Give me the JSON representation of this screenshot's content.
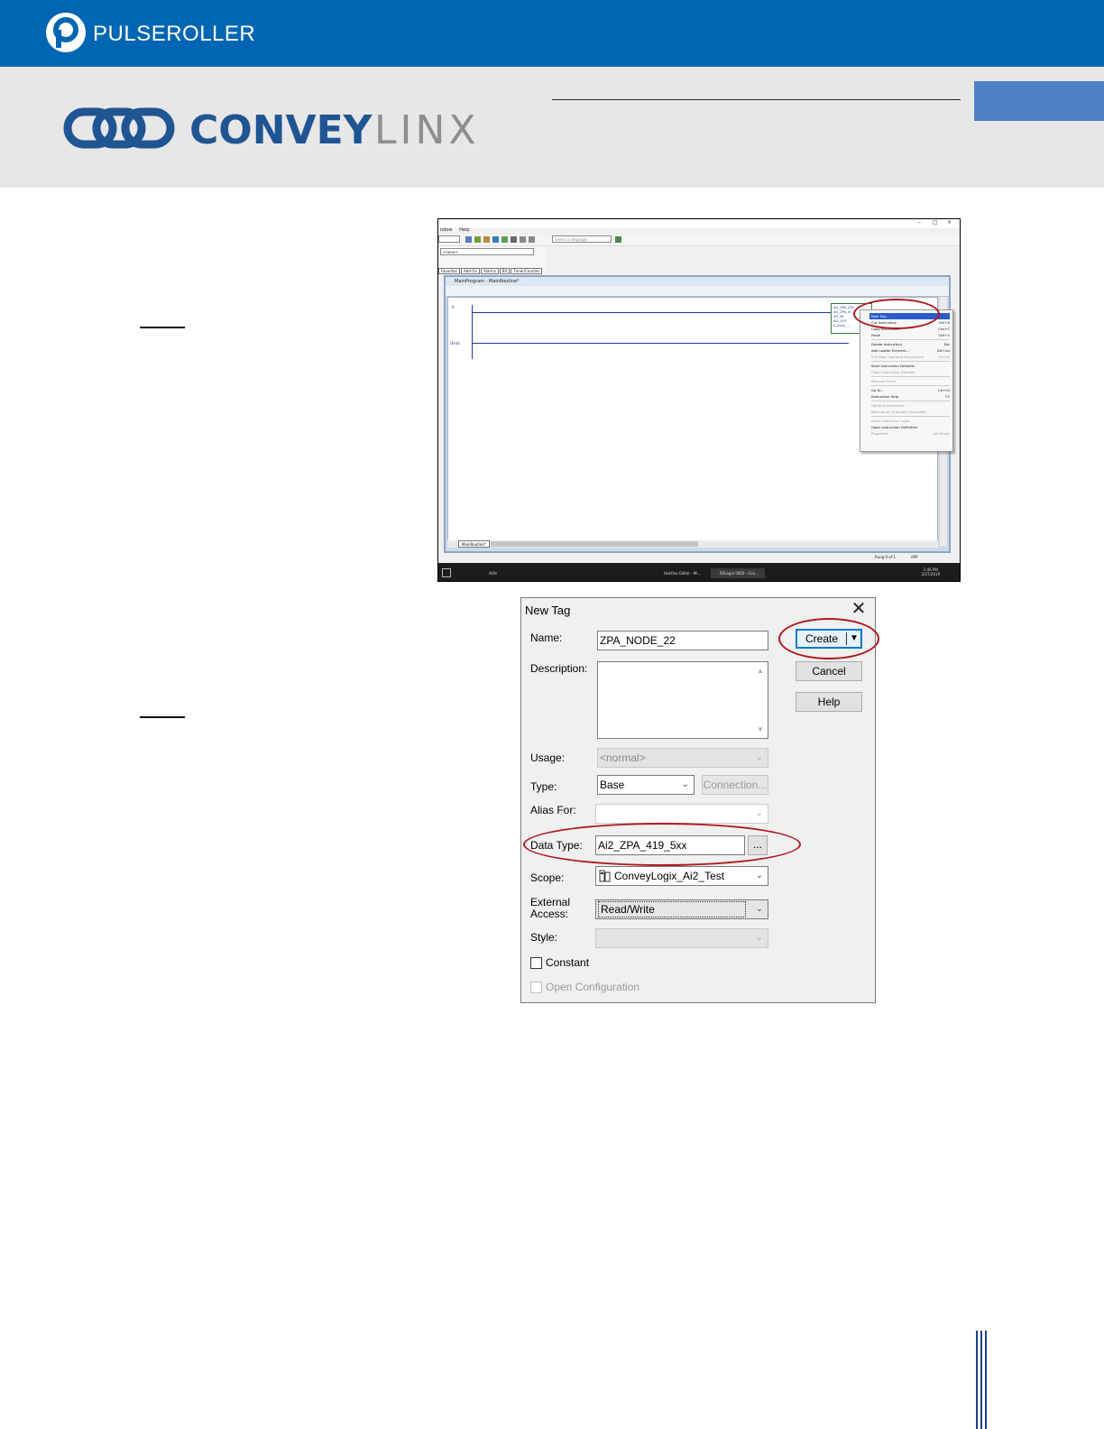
{
  "header": {
    "brand": "PULSEROLLER",
    "product_brand_bold": "CONVEY",
    "product_brand_light": "LINX",
    "colors": {
      "top_bar": "#0066b3",
      "band": "#e7e7e8",
      "accent_box": "#4f81c7",
      "conveylinx_blue": "#1f5592",
      "linx_gray": "#8d8e90",
      "highlight_red": "#b0161e"
    }
  },
  "screenshot1": {
    "menu": [
      "ndow",
      "Help"
    ],
    "language_placeholder": "Select a language...",
    "left_combo": "<none>",
    "tabs": [
      "Favorites",
      "Add-On",
      "Alarms",
      "Bit",
      "Timer/Counter"
    ],
    "child_window_title": "MainProgram - MainRoutine*",
    "rung_start": "0",
    "rung_end": "(End)",
    "aoi_lines": [
      "Ai2_ZPA_419",
      "Ai2_ZPA_In",
      "AI2_IN",
      "AI2_OUT",
      "S_Zone_..."
    ],
    "context_menu": [
      {
        "label": "New Tag...",
        "shortcut": "",
        "highlight": true
      },
      {
        "label": "Cut Instruction",
        "shortcut": "Ctrl+X"
      },
      {
        "label": "Copy Instruction",
        "shortcut": "Ctrl+C"
      },
      {
        "label": "Paste",
        "shortcut": "Ctrl+V"
      },
      {
        "sep": true
      },
      {
        "label": "Delete Instruction",
        "shortcut": "Del"
      },
      {
        "label": "Add Ladder Element...",
        "shortcut": "Alt+Ins"
      },
      {
        "label": "Edit Main Operand Description",
        "shortcut": "Ctrl+D",
        "disabled": true
      },
      {
        "sep": true
      },
      {
        "label": "Save Instruction Defaults",
        "shortcut": ""
      },
      {
        "label": "Clear Instruction Defaults",
        "shortcut": "",
        "disabled": true
      },
      {
        "sep": true
      },
      {
        "label": "Remove Force",
        "shortcut": "",
        "disabled": true
      },
      {
        "sep": true
      },
      {
        "label": "Go To...",
        "shortcut": "Ctrl+G"
      },
      {
        "label": "Instruction Help",
        "shortcut": "F1"
      },
      {
        "sep": true
      },
      {
        "label": "Optional Parameter",
        "shortcut": "",
        "disabled": true
      },
      {
        "label": "Remove All Unknown Parameter",
        "shortcut": "",
        "disabled": true
      },
      {
        "sep": true
      },
      {
        "label": "Open Instruction Logic",
        "shortcut": "",
        "disabled": true
      },
      {
        "label": "Open Instruction Definition",
        "shortcut": ""
      },
      {
        "label": "Properties",
        "shortcut": "Alt+Enter",
        "disabled": true
      }
    ],
    "sheet_tab": "MainRoutine*",
    "status_text": "Rung 0 of 1",
    "status_mode": "APP",
    "taskbar": [
      {
        "label": "AOIs"
      },
      {
        "label": "testOne Editor - Mi..."
      },
      {
        "label": "RSLogix 5000 - Con...",
        "active": true
      }
    ],
    "clock_time": "1:46 PM",
    "clock_date": "2/27/2019"
  },
  "dialog": {
    "title": "New Tag",
    "close_glyph": "✕",
    "name_label": "Name:",
    "name_value": "ZPA_NODE_22",
    "description_label": "Description:",
    "usage_label": "Usage:",
    "usage_value": "<normal>",
    "type_label": "Type:",
    "type_value": "Base",
    "connection_button": "Connection...",
    "alias_label": "Alias For:",
    "data_type_label": "Data Type:",
    "data_type_value": "Ai2_ZPA_419_5xx",
    "browse_button": "...",
    "scope_label": "Scope:",
    "scope_value": "ConveyLogix_Ai2_Test",
    "external_label_1": "External",
    "external_label_2": "Access:",
    "external_value": "Read/Write",
    "style_label": "Style:",
    "constant_label": "Constant",
    "open_config_label": "Open Configuration",
    "create_button": "Create",
    "cancel_button": "Cancel",
    "help_button": "Help"
  }
}
